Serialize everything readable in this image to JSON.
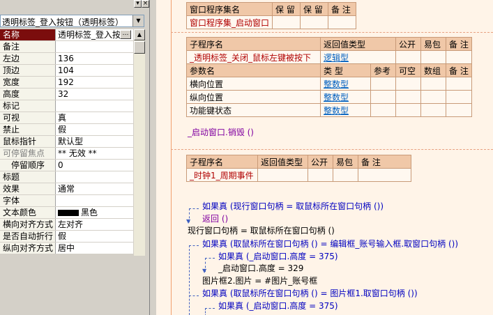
{
  "panel": {
    "combo_value": "透明标签_登入按钮（透明标签）",
    "properties": [
      {
        "name": "名称",
        "value": "透明标签_登入按",
        "selected": true,
        "has_button": true
      },
      {
        "name": "备注",
        "value": ""
      },
      {
        "name": "左边",
        "value": "136"
      },
      {
        "name": "顶边",
        "value": "104"
      },
      {
        "name": "宽度",
        "value": "192"
      },
      {
        "name": "高度",
        "value": "32"
      },
      {
        "name": "标记",
        "value": ""
      },
      {
        "name": "可视",
        "value": "真"
      },
      {
        "name": "禁止",
        "value": "假"
      },
      {
        "name": "鼠标指针",
        "value": "默认型"
      },
      {
        "name": "可停留焦点",
        "value": "** 无效 **",
        "grey": true
      },
      {
        "name": "停留顺序",
        "value": "0",
        "indent": true
      },
      {
        "name": "标题",
        "value": ""
      },
      {
        "name": "效果",
        "value": "通常"
      },
      {
        "name": "字体",
        "value": ""
      },
      {
        "name": "文本颜色",
        "value": "黑色",
        "swatch": "#000000"
      },
      {
        "name": "横向对齐方式",
        "value": "左对齐"
      },
      {
        "name": "是否自动折行",
        "value": "假"
      },
      {
        "name": "纵向对齐方式",
        "value": "居中"
      }
    ]
  },
  "code": {
    "assembly_table": {
      "headers": [
        "窗口程序集名",
        "保 留",
        "保 留",
        "备 注"
      ],
      "row": [
        "窗口程序集_启动窗口",
        "",
        "",
        ""
      ]
    },
    "sub1": {
      "headers": [
        "子程序名",
        "返回值类型",
        "公开",
        "易包",
        "备 注"
      ],
      "row": [
        "_透明标签_关闭_鼠标左键被按下",
        "逻辑型",
        "",
        "",
        ""
      ],
      "param_headers": [
        "参数名",
        "类 型",
        "参考",
        "可空",
        "数组",
        "备 注"
      ],
      "params": [
        [
          "横向位置",
          "整数型"
        ],
        [
          "纵向位置",
          "整数型"
        ],
        [
          "功能键状态",
          "整数型"
        ]
      ],
      "body": "_启动窗口.销毁 ()"
    },
    "sub2": {
      "headers": [
        "子程序名",
        "返回值类型",
        "公开",
        "易包",
        "备 注"
      ],
      "row": [
        "_时钟1_周期事件",
        "",
        "",
        "",
        ""
      ]
    },
    "lines": [
      {
        "text": "如果真 (现行窗口句柄 = 取鼠标所在窗口句柄 ())"
      },
      {
        "text": "返回 ()"
      },
      {
        "text": "现行窗口句柄 = 取鼠标所在窗口句柄 ()"
      },
      {
        "text": "如果真 (取鼠标所在窗口句柄 () = 编辑框_账号输入框.取窗口句柄 ())"
      },
      {
        "text": "如果真 (_启动窗口.高度 = 375)"
      },
      {
        "text": "_启动窗口.高度 = 329"
      },
      {
        "text": "图片框2.图片 = #图片_账号框"
      },
      {
        "text": "如果真 (取鼠标所在窗口句柄 () = 图片框1.取窗口句柄 ())"
      },
      {
        "text": "如果真 (_启动窗口.高度 = 375)"
      }
    ]
  }
}
